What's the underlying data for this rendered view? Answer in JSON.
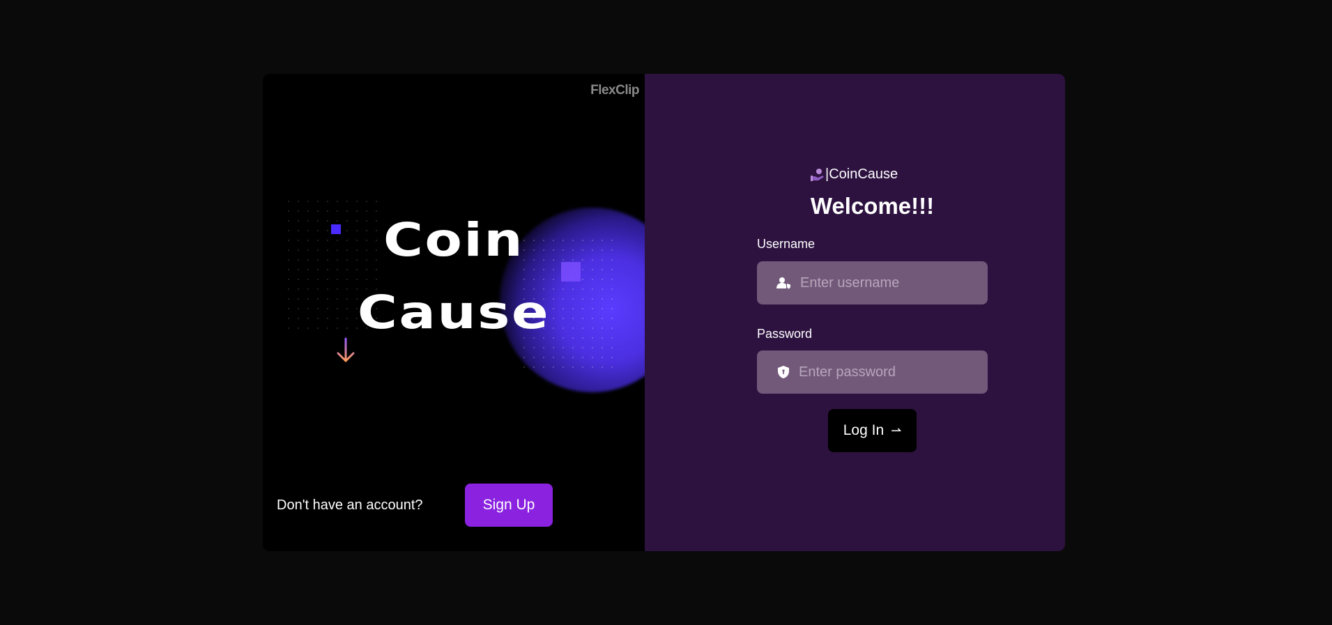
{
  "left_panel": {
    "watermark": "FlexClip",
    "brand_line1": "Coin",
    "brand_line2": "Cause",
    "signup_prompt": "Don't have an account?",
    "signup_label": "Sign Up"
  },
  "right_panel": {
    "logo_text": "|CoinCause",
    "welcome": "Welcome!!!",
    "username_label": "Username",
    "username_placeholder": "Enter username",
    "password_label": "Password",
    "password_placeholder": "Enter password",
    "login_label": "Log In",
    "login_arrow": "⇀"
  },
  "colors": {
    "accent": "#8a22e0",
    "panel": "#2d1240",
    "field": "#72597a"
  }
}
